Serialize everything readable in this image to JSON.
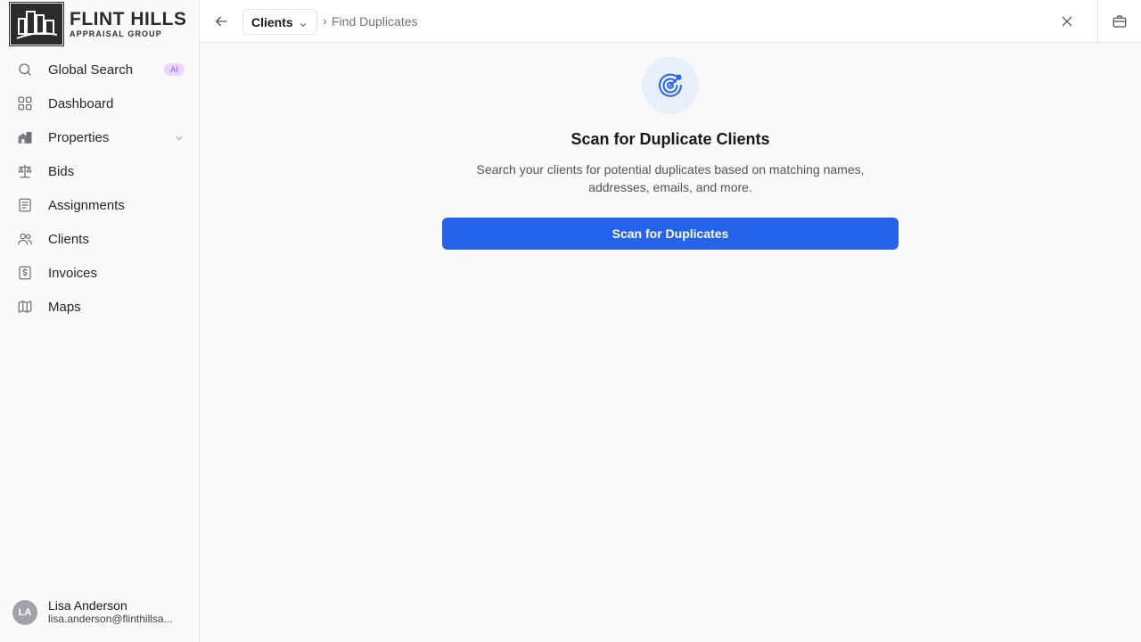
{
  "brand": {
    "name": "FLINT HILLS",
    "subtitle": "APPRAISAL GROUP"
  },
  "sidebar": {
    "items": [
      {
        "label": "Global Search",
        "icon": "search-icon",
        "badge": "AI"
      },
      {
        "label": "Dashboard",
        "icon": "dashboard-grid-icon"
      },
      {
        "label": "Properties",
        "icon": "properties-building-icon",
        "expandable": true
      },
      {
        "label": "Bids",
        "icon": "scale-icon"
      },
      {
        "label": "Assignments",
        "icon": "clipboard-list-icon"
      },
      {
        "label": "Clients",
        "icon": "users-icon"
      },
      {
        "label": "Invoices",
        "icon": "invoice-dollar-icon"
      },
      {
        "label": "Maps",
        "icon": "map-icon"
      }
    ]
  },
  "user": {
    "initials": "LA",
    "name": "Lisa Anderson",
    "email": "lisa.anderson@flinthillsa..."
  },
  "header": {
    "breadcrumb_root": "Clients",
    "breadcrumb_separator": "›",
    "breadcrumb_current": "Find Duplicates"
  },
  "main": {
    "title": "Scan for Duplicate Clients",
    "description": "Search your clients for potential duplicates based on matching names, addresses, emails, and more.",
    "scan_button_label": "Scan for Duplicates"
  },
  "colors": {
    "accent": "#2563eb",
    "icon_circle_bg": "#e8effa",
    "ai_badge_bg": "#e9d5ff",
    "ai_badge_text": "#a855f7"
  }
}
